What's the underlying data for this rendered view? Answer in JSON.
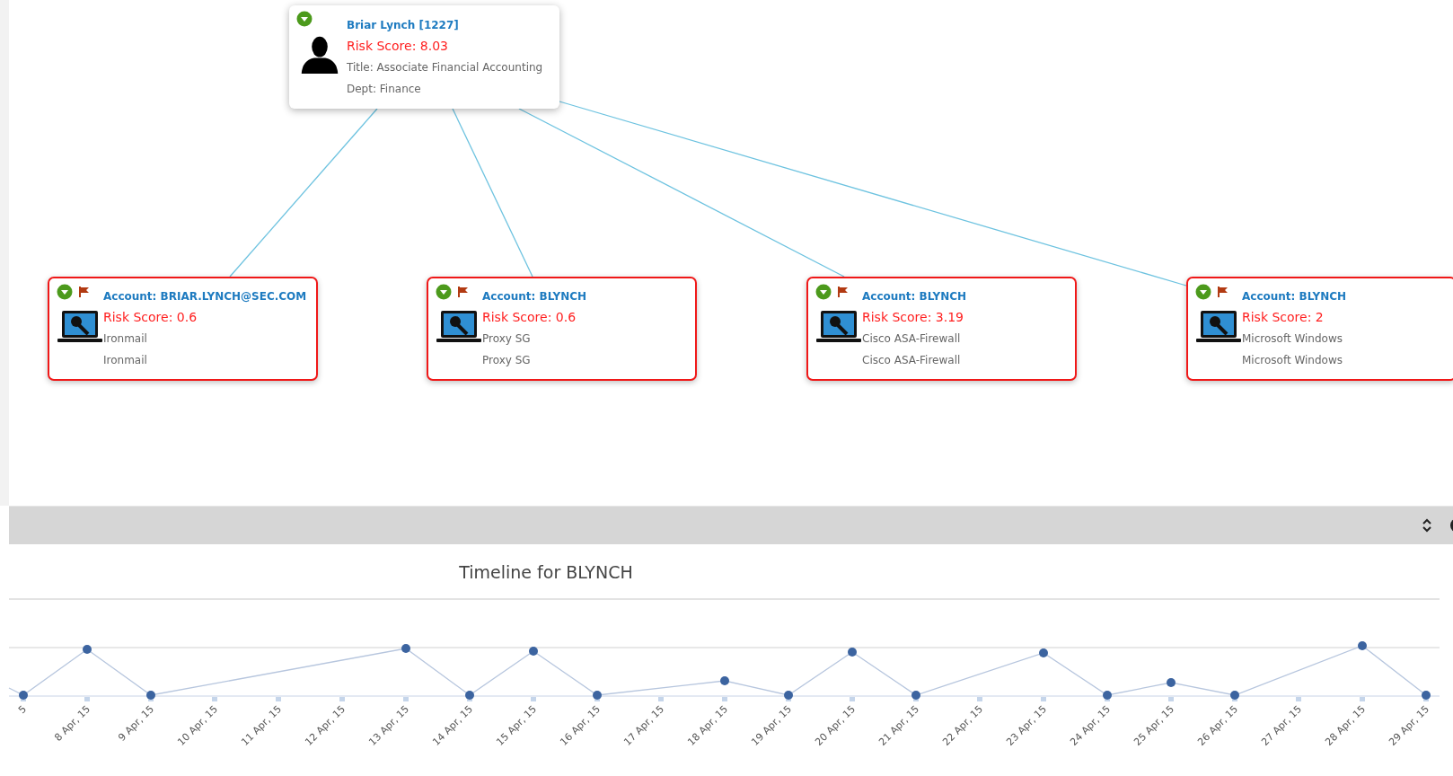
{
  "graph": {
    "root": {
      "name": "Briar Lynch [1227]",
      "risk": "Risk Score: 8.03",
      "lines": [
        "Title: Associate Financial Accounting",
        "Dept: Finance"
      ],
      "flagged": false
    },
    "accounts": [
      {
        "name": "Account: BRIAR.LYNCH@SEC.COM",
        "risk": "Risk Score: 0.6",
        "lines": [
          "Ironmail",
          "Ironmail"
        ],
        "flagged": true
      },
      {
        "name": "Account: BLYNCH",
        "risk": "Risk Score: 0.6",
        "lines": [
          "Proxy SG",
          "Proxy SG"
        ],
        "flagged": true
      },
      {
        "name": "Account: BLYNCH",
        "risk": "Risk Score: 3.19",
        "lines": [
          "Cisco ASA-Firewall",
          "Cisco ASA-Firewall"
        ],
        "flagged": true
      },
      {
        "name": "Account: BLYNCH",
        "risk": "Risk Score: 2",
        "lines": [
          "Microsoft Windows",
          "Microsoft Windows"
        ],
        "flagged": true
      }
    ]
  },
  "timeline": {
    "title": "Timeline for BLYNCH",
    "x_labels": [
      "5",
      "8 Apr, 15",
      "9 Apr, 15",
      "10 Apr, 15",
      "11 Apr, 15",
      "12 Apr, 15",
      "13 Apr, 15",
      "14 Apr, 15",
      "15 Apr, 15",
      "16 Apr, 15",
      "17 Apr, 15",
      "18 Apr, 15",
      "19 Apr, 15",
      "20 Apr, 15",
      "21 Apr, 15",
      "22 Apr, 15",
      "23 Apr, 15",
      "24 Apr, 15",
      "25 Apr, 15",
      "26 Apr, 15",
      "27 Apr, 15",
      "28 Apr, 15",
      "29 Apr, 15"
    ]
  }
}
